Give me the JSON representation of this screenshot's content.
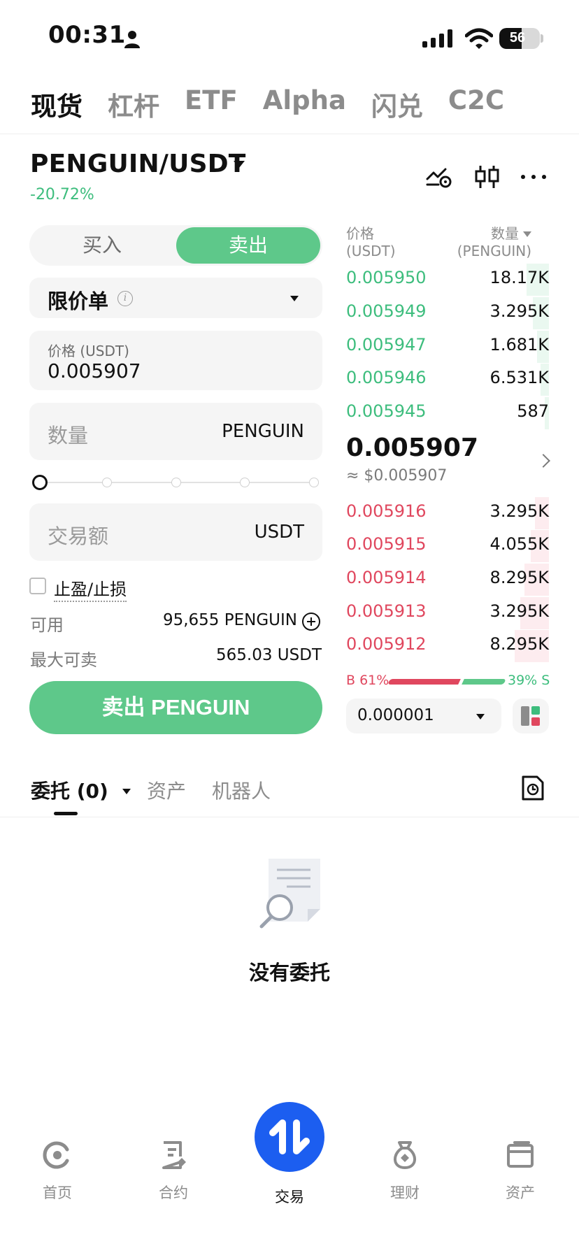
{
  "status_bar": {
    "time": "00:31",
    "battery": "56"
  },
  "top_tabs": [
    {
      "label": "现货",
      "active": true
    },
    {
      "label": "杠杆",
      "active": false
    },
    {
      "label": "ETF",
      "active": false
    },
    {
      "label": "Alpha",
      "active": false
    },
    {
      "label": "闪兑",
      "active": false
    },
    {
      "label": "C2C",
      "active": false
    }
  ],
  "pair": {
    "name": "PENGUIN/USDT",
    "change": "-20.72%"
  },
  "order_form": {
    "buy_label": "买入",
    "sell_label": "卖出",
    "order_type": "限价单",
    "price_label": "价格 (USDT)",
    "price_value": "0.005907",
    "qty_placeholder": "数量",
    "qty_unit": "PENGUIN",
    "slider_percent": 0,
    "amount_placeholder": "交易额",
    "amount_unit": "USDT",
    "tpsl_label": "止盈/止损",
    "available_label": "可用",
    "available_value": "95,655 PENGUIN",
    "max_sell_label": "最大可卖",
    "max_sell_value": "565.03 USDT",
    "submit_label": "卖出 PENGUIN"
  },
  "order_book": {
    "price_header": "价格",
    "price_unit": "(USDT)",
    "qty_header": "数量",
    "qty_unit": "(PENGUIN)",
    "asks": [
      {
        "price": "0.005950",
        "qty": "18.17K",
        "depth": 0.11
      },
      {
        "price": "0.005949",
        "qty": "3.295K",
        "depth": 0.08
      },
      {
        "price": "0.005947",
        "qty": "1.681K",
        "depth": 0.06
      },
      {
        "price": "0.005946",
        "qty": "6.531K",
        "depth": 0.04
      },
      {
        "price": "0.005945",
        "qty": "587",
        "depth": 0.02
      }
    ],
    "last_price": "0.005907",
    "last_price_usd": "≈ $0.005907",
    "bids": [
      {
        "price": "0.005916",
        "qty": "3.295K",
        "depth": 0.07
      },
      {
        "price": "0.005915",
        "qty": "4.055K",
        "depth": 0.09
      },
      {
        "price": "0.005914",
        "qty": "8.295K",
        "depth": 0.12
      },
      {
        "price": "0.005913",
        "qty": "3.295K",
        "depth": 0.14
      },
      {
        "price": "0.005912",
        "qty": "8.295K",
        "depth": 0.17
      }
    ],
    "buy_ratio": "B 61%",
    "sell_ratio": "39% S",
    "tick_size": "0.000001"
  },
  "section_tabs": {
    "orders": "委托 (0)",
    "assets": "资产",
    "bots": "机器人"
  },
  "empty_state": "没有委托",
  "bottom_nav": [
    {
      "label": "首页",
      "icon": "home-icon"
    },
    {
      "label": "合约",
      "icon": "futures-icon"
    },
    {
      "label": "交易",
      "icon": "trade-icon"
    },
    {
      "label": "理财",
      "icon": "earn-icon"
    },
    {
      "label": "资产",
      "icon": "wallet-icon"
    }
  ],
  "colors": {
    "green": "#5ec88a",
    "red": "#e0475e",
    "blue": "#1c5ef0"
  }
}
